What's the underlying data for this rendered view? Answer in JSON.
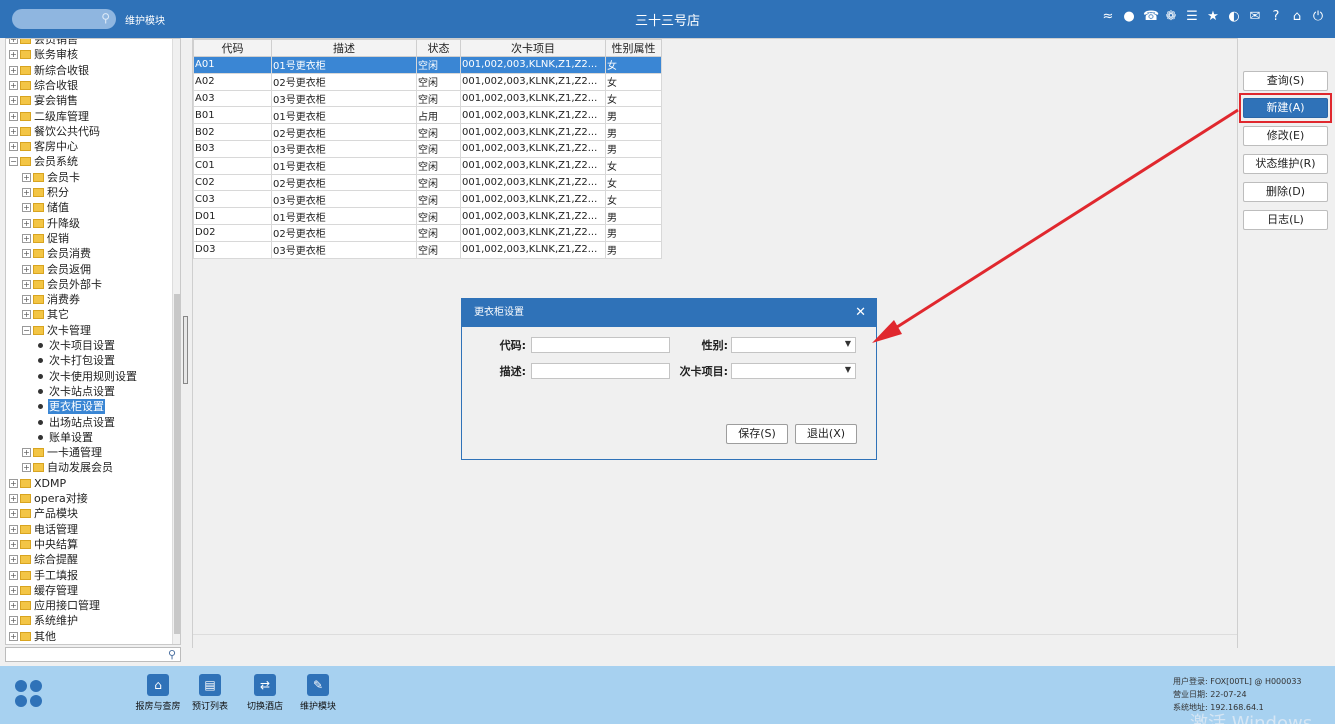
{
  "topbar": {
    "module": "维护模块",
    "title": "三十三号店",
    "icons": [
      "wifi-icon",
      "message-icon",
      "phone-icon",
      "palette-icon",
      "menu-icon",
      "star-icon",
      "contrast-icon",
      "mail-icon",
      "help-icon",
      "home-icon",
      "power-icon"
    ]
  },
  "tree": {
    "items": [
      {
        "label": "会员销售",
        "level": 0,
        "type": "folder"
      },
      {
        "label": "账务审核",
        "level": 0,
        "type": "folder"
      },
      {
        "label": "新综合收银",
        "level": 0,
        "type": "folder"
      },
      {
        "label": "综合收银",
        "level": 0,
        "type": "folder"
      },
      {
        "label": "宴会销售",
        "level": 0,
        "type": "folder"
      },
      {
        "label": "二级库管理",
        "level": 0,
        "type": "folder"
      },
      {
        "label": "餐饮公共代码",
        "level": 0,
        "type": "folder"
      },
      {
        "label": "客房中心",
        "level": 0,
        "type": "folder"
      },
      {
        "label": "会员系统",
        "level": 0,
        "type": "folder-open"
      },
      {
        "label": "会员卡",
        "level": 1,
        "type": "folder"
      },
      {
        "label": "积分",
        "level": 1,
        "type": "folder"
      },
      {
        "label": "储值",
        "level": 1,
        "type": "folder"
      },
      {
        "label": "升降级",
        "level": 1,
        "type": "folder"
      },
      {
        "label": "促销",
        "level": 1,
        "type": "folder"
      },
      {
        "label": "会员消费",
        "level": 1,
        "type": "folder"
      },
      {
        "label": "会员返佣",
        "level": 1,
        "type": "folder"
      },
      {
        "label": "会员外部卡",
        "level": 1,
        "type": "folder"
      },
      {
        "label": "消费券",
        "level": 1,
        "type": "folder"
      },
      {
        "label": "其它",
        "level": 1,
        "type": "folder"
      },
      {
        "label": "次卡管理",
        "level": 1,
        "type": "folder-open"
      },
      {
        "label": "次卡项目设置",
        "level": 2,
        "type": "leaf"
      },
      {
        "label": "次卡打包设置",
        "level": 2,
        "type": "leaf"
      },
      {
        "label": "次卡使用规则设置",
        "level": 2,
        "type": "leaf"
      },
      {
        "label": "次卡站点设置",
        "level": 2,
        "type": "leaf"
      },
      {
        "label": "更衣柜设置",
        "level": 2,
        "type": "leaf",
        "selected": true
      },
      {
        "label": "出场站点设置",
        "level": 2,
        "type": "leaf"
      },
      {
        "label": "账单设置",
        "level": 2,
        "type": "leaf"
      },
      {
        "label": "一卡通管理",
        "level": 1,
        "type": "folder"
      },
      {
        "label": "自动发展会员",
        "level": 1,
        "type": "folder"
      },
      {
        "label": "XDMP",
        "level": 0,
        "type": "folder"
      },
      {
        "label": "opera对接",
        "level": 0,
        "type": "folder"
      },
      {
        "label": "产品模块",
        "level": 0,
        "type": "folder"
      },
      {
        "label": "电话管理",
        "level": 0,
        "type": "folder"
      },
      {
        "label": "中央结算",
        "level": 0,
        "type": "folder"
      },
      {
        "label": "综合提醒",
        "level": 0,
        "type": "folder"
      },
      {
        "label": "手工填报",
        "level": 0,
        "type": "folder"
      },
      {
        "label": "缓存管理",
        "level": 0,
        "type": "folder"
      },
      {
        "label": "应用接口管理",
        "level": 0,
        "type": "folder"
      },
      {
        "label": "系统维护",
        "level": 0,
        "type": "folder"
      },
      {
        "label": "其他",
        "level": 0,
        "type": "folder"
      }
    ]
  },
  "grid": {
    "columns": [
      "代码",
      "描述",
      "状态",
      "次卡项目",
      "性别属性"
    ],
    "rows": [
      [
        "A01",
        "01号更衣柜",
        "空闲",
        "001,002,003,KLNK,Z1,Z2...",
        "女"
      ],
      [
        "A02",
        "02号更衣柜",
        "空闲",
        "001,002,003,KLNK,Z1,Z2...",
        "女"
      ],
      [
        "A03",
        "03号更衣柜",
        "空闲",
        "001,002,003,KLNK,Z1,Z2...",
        "女"
      ],
      [
        "B01",
        "01号更衣柜",
        "占用",
        "001,002,003,KLNK,Z1,Z2...",
        "男"
      ],
      [
        "B02",
        "02号更衣柜",
        "空闲",
        "001,002,003,KLNK,Z1,Z2...",
        "男"
      ],
      [
        "B03",
        "03号更衣柜",
        "空闲",
        "001,002,003,KLNK,Z1,Z2...",
        "男"
      ],
      [
        "C01",
        "01号更衣柜",
        "空闲",
        "001,002,003,KLNK,Z1,Z2...",
        "女"
      ],
      [
        "C02",
        "02号更衣柜",
        "空闲",
        "001,002,003,KLNK,Z1,Z2...",
        "女"
      ],
      [
        "C03",
        "03号更衣柜",
        "空闲",
        "001,002,003,KLNK,Z1,Z2...",
        "女"
      ],
      [
        "D01",
        "01号更衣柜",
        "空闲",
        "001,002,003,KLNK,Z1,Z2...",
        "男"
      ],
      [
        "D02",
        "02号更衣柜",
        "空闲",
        "001,002,003,KLNK,Z1,Z2...",
        "男"
      ],
      [
        "D03",
        "03号更衣柜",
        "空闲",
        "001,002,003,KLNK,Z1,Z2...",
        "男"
      ]
    ],
    "selected_row": 0
  },
  "actions": {
    "query": "查询(S)",
    "new": "新建(A)",
    "edit": "修改(E)",
    "status": "状态维护(R)",
    "delete": "删除(D)",
    "log": "日志(L)"
  },
  "dialog": {
    "title": "更衣柜设置",
    "close": "✕",
    "code_label": "代码:",
    "code_value": "",
    "gender_label": "性别:",
    "gender_value": "",
    "desc_label": "描述:",
    "desc_value": "",
    "item_label": "次卡项目:",
    "item_value": "",
    "save": "保存(S)",
    "exit": "退出(X)"
  },
  "bottombar": {
    "items": [
      {
        "label": "报房与查房",
        "icon": "house-search-icon"
      },
      {
        "label": "预订列表",
        "icon": "reservation-list-icon"
      },
      {
        "label": "切换酒店",
        "icon": "switch-hotel-icon"
      },
      {
        "label": "维护模块",
        "icon": "wrench-icon"
      }
    ],
    "sysinfo": {
      "user": "用户登录:  FOX[00TL] @ H000033",
      "date": "营业日期:  22-07-24",
      "address": "系统地址:  192.168.64.1"
    },
    "watermark": "激活 Windows"
  },
  "colors": {
    "primary": "#2f72b8",
    "bottom": "#a7d1f0",
    "highlight": "#e0282e"
  }
}
